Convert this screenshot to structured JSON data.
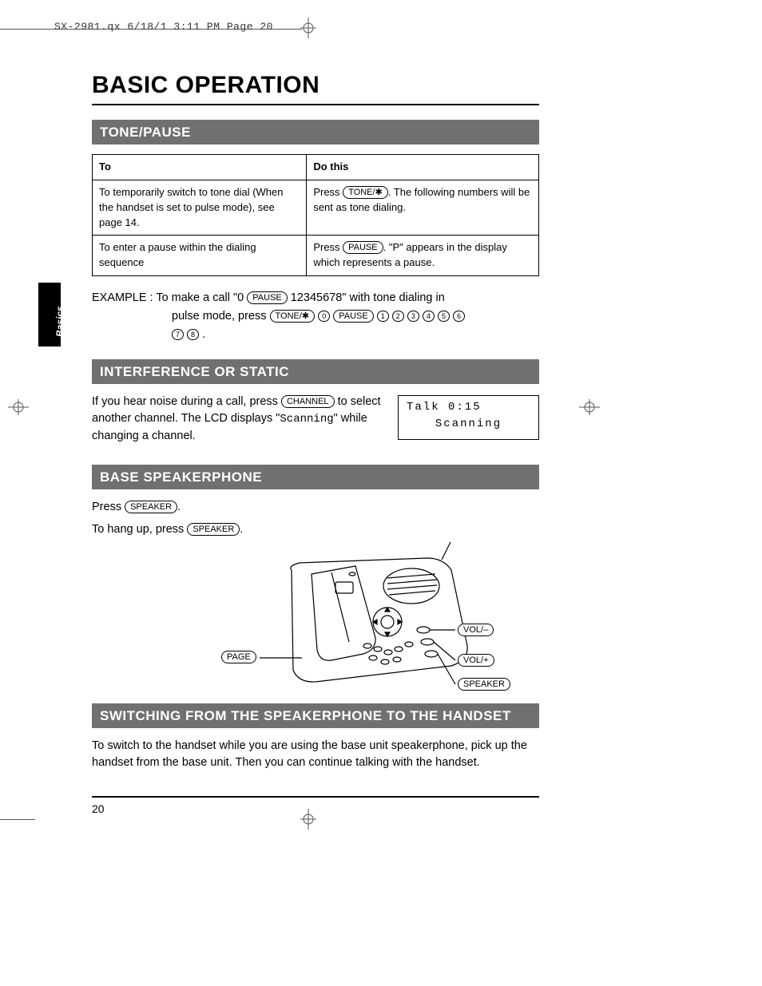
{
  "slug": "SX-2981.qx  6/18/1 3:11 PM  Page 20",
  "side_tab": "Basics",
  "page_title": "BASIC OPERATION",
  "page_number": "20",
  "sections": {
    "tone_pause": {
      "header": "TONE/PAUSE",
      "table": {
        "col1_header": "To",
        "col2_header": "Do this",
        "rows": [
          {
            "to": "To temporarily switch to tone dial (When the handset is set to pulse mode), see page 14.",
            "do_pre": "Press ",
            "do_btn": "TONE/✱",
            "do_post": ". The following numbers will be sent as tone dialing."
          },
          {
            "to": "To enter a pause within the dialing sequence",
            "do_pre": "Press ",
            "do_btn": "PAUSE",
            "do_post": ". \"P\" appears in the display which represents a pause."
          }
        ]
      },
      "example": {
        "lead": "EXAMPLE : To make a call \"0",
        "pause_btn": "PAUSE",
        "after_pause_num": "12345678\" with tone dialing in",
        "line2_pre": "pulse mode, press ",
        "tone_btn": "TONE/✱",
        "digits1": [
          "0"
        ],
        "pause_btn2": "PAUSE",
        "digits2": [
          "1",
          "2",
          "3",
          "4",
          "5",
          "6"
        ],
        "digits3": [
          "7",
          "8"
        ],
        "period": "."
      }
    },
    "interference": {
      "header": "INTERFERENCE OR STATIC",
      "text_pre": "If you hear noise during a call, press ",
      "channel_btn": "CHANNEL",
      "text_mid": " to select another channel.  The LCD displays \"",
      "scanning_mono": "Scanning",
      "text_post": "\" while changing a channel.",
      "lcd": {
        "line1": "Talk   0:15",
        "line2": "Scanning"
      }
    },
    "speakerphone": {
      "header": "BASE SPEAKERPHONE",
      "line1_pre": "Press ",
      "speaker_btn": "SPEAKER",
      "line1_post": ".",
      "line2_pre": "To hang up, press ",
      "line2_post": ".",
      "callouts": {
        "page": "PAGE",
        "vol_minus": "VOL/–",
        "vol_plus": "VOL/+",
        "speaker": "SPEAKER"
      }
    },
    "switching": {
      "header": "SWITCHING FROM THE SPEAKERPHONE TO THE HANDSET",
      "body": "To switch to the handset while you are using the base unit speakerphone, pick up the handset from the base unit. Then you can continue talking with the handset."
    }
  }
}
